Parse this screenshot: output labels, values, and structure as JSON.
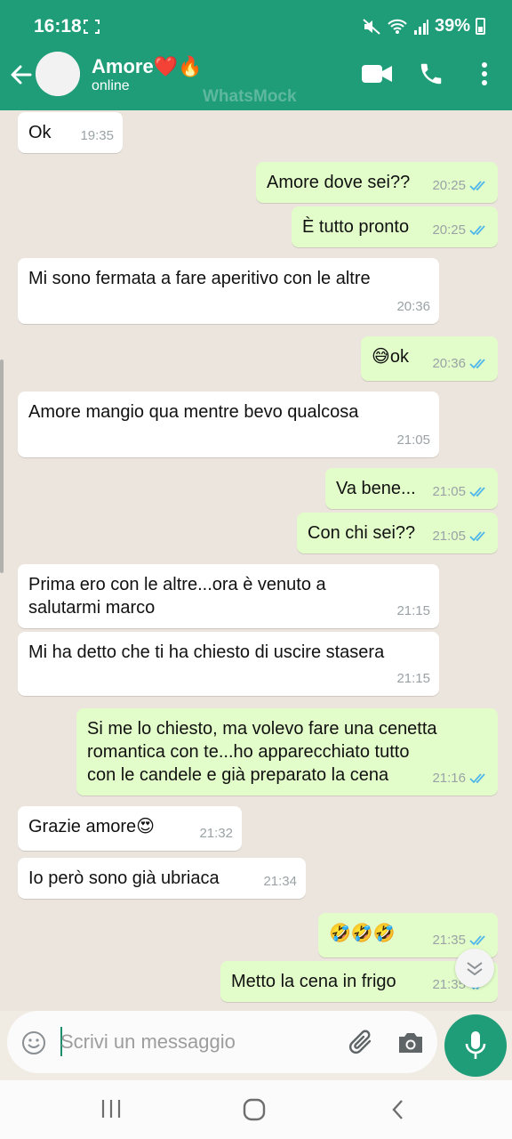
{
  "status_bar": {
    "time": "16:18",
    "battery": "39%"
  },
  "header": {
    "contact_name": "Amore❤️🔥",
    "contact_status": "online",
    "watermark": "WhatsMock"
  },
  "messages": [
    {
      "dir": "in",
      "text": "Ok",
      "time": "19:35"
    },
    {
      "dir": "out",
      "text": "Amore dove sei??",
      "time": "20:25",
      "ticks": "read"
    },
    {
      "dir": "out",
      "text": "È tutto pronto",
      "time": "20:25",
      "ticks": "read"
    },
    {
      "dir": "in",
      "text": "Mi sono fermata a fare aperitivo con le altre",
      "time": "20:36"
    },
    {
      "dir": "out",
      "text": "😅ok",
      "time": "20:36",
      "ticks": "read"
    },
    {
      "dir": "in",
      "text": "Amore mangio qua mentre bevo qualcosa",
      "time": "21:05"
    },
    {
      "dir": "out",
      "text": "Va bene...",
      "time": "21:05",
      "ticks": "read"
    },
    {
      "dir": "out",
      "text": "Con chi sei??",
      "time": "21:05",
      "ticks": "read"
    },
    {
      "dir": "in",
      "text": "Prima ero con le altre...ora è venuto a\nsalutarmi marco",
      "time": "21:15"
    },
    {
      "dir": "in",
      "text": "Mi ha detto che ti ha chiesto di uscire stasera",
      "time": "21:15"
    },
    {
      "dir": "out",
      "text": "Si me lo chiesto, ma volevo fare una cenetta\nromantica con te...ho apparecchiato tutto\ncon le candele e già preparato la cena",
      "time": "21:16",
      "ticks": "read"
    },
    {
      "dir": "in",
      "text": "Grazie amore😍",
      "time": "21:32"
    },
    {
      "dir": "in",
      "text": "Io però sono già ubriaca",
      "time": "21:34"
    },
    {
      "dir": "out",
      "text": "🤣🤣🤣",
      "time": "21:35",
      "ticks": "read"
    },
    {
      "dir": "out",
      "text": "Metto la cena in frigo",
      "time": "21:35",
      "ticks": "read"
    }
  ],
  "input": {
    "placeholder": "Scrivi un messaggio"
  },
  "colors": {
    "brand": "#1f9d78",
    "outgoing_bubble": "#e2fdc9",
    "incoming_bubble": "#ffffff",
    "read_ticks": "#4fb6ec"
  },
  "icons": [
    "back-arrow-icon",
    "avatar-placeholder-icon",
    "video-call-icon",
    "phone-icon",
    "more-options-icon",
    "emoji-icon",
    "attach-icon",
    "camera-icon",
    "mic-icon",
    "scroll-down-chevron-icon",
    "nav-recents-icon",
    "nav-home-icon",
    "nav-back-icon"
  ]
}
